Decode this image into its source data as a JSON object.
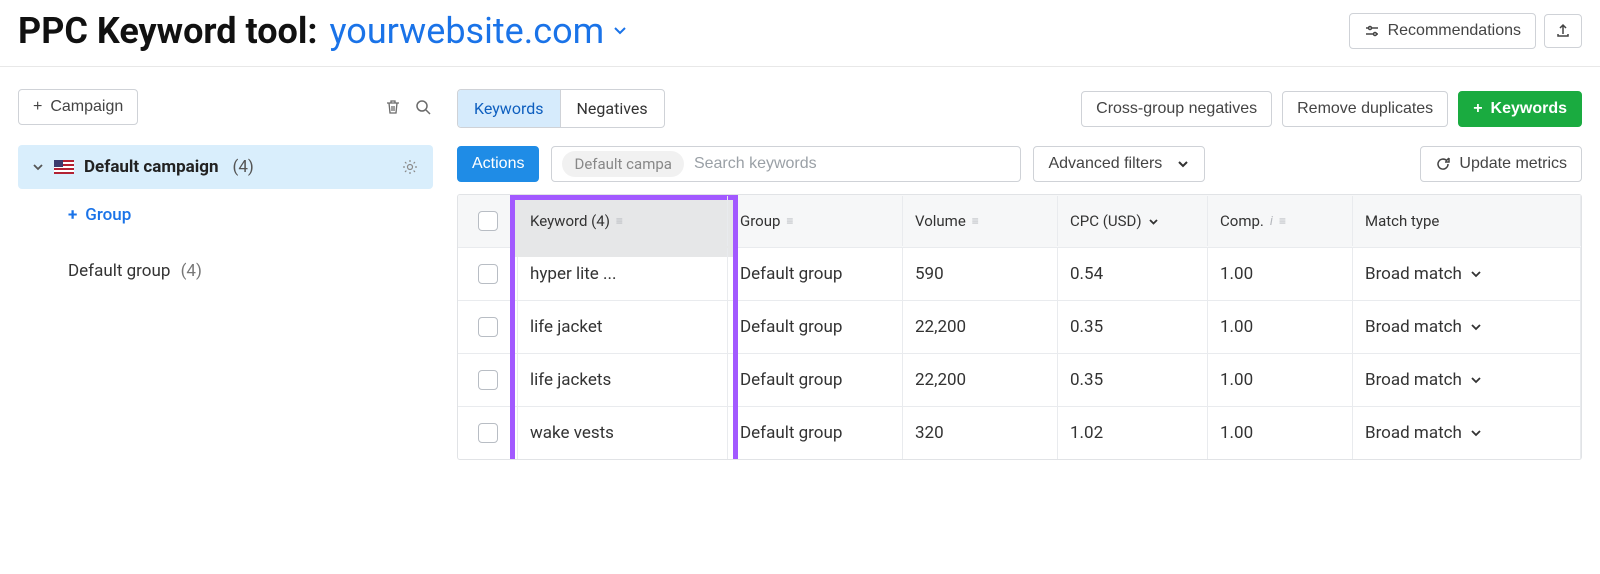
{
  "header": {
    "title": "PPC Keyword tool:",
    "site": "yourwebsite.com",
    "recommendations": "Recommendations"
  },
  "left": {
    "add_campaign": "Campaign",
    "campaign_name": "Default campaign",
    "campaign_count": "(4)",
    "add_group": "Group",
    "default_group_label": "Default group",
    "default_group_count": "(4)"
  },
  "tabs": {
    "keywords": "Keywords",
    "negatives": "Negatives"
  },
  "toolbar": {
    "cross_group": "Cross-group negatives",
    "remove_dup": "Remove duplicates",
    "add_keywords": "Keywords",
    "actions": "Actions",
    "chip": "Default campa",
    "search_placeholder": "Search keywords",
    "advanced": "Advanced filters",
    "update": "Update metrics"
  },
  "columns": {
    "keyword": "Keyword (4)",
    "group": "Group",
    "volume": "Volume",
    "cpc": "CPC (USD)",
    "comp": "Comp.",
    "match": "Match type"
  },
  "rows": [
    {
      "keyword": "hyper lite ...",
      "group": "Default group",
      "volume": "590",
      "cpc": "0.54",
      "comp": "1.00",
      "match": "Broad match"
    },
    {
      "keyword": "life jacket",
      "group": "Default group",
      "volume": "22,200",
      "cpc": "0.35",
      "comp": "1.00",
      "match": "Broad match"
    },
    {
      "keyword": "life jackets",
      "group": "Default group",
      "volume": "22,200",
      "cpc": "0.35",
      "comp": "1.00",
      "match": "Broad match"
    },
    {
      "keyword": "wake vests",
      "group": "Default group",
      "volume": "320",
      "cpc": "1.02",
      "comp": "1.00",
      "match": "Broad match"
    }
  ]
}
